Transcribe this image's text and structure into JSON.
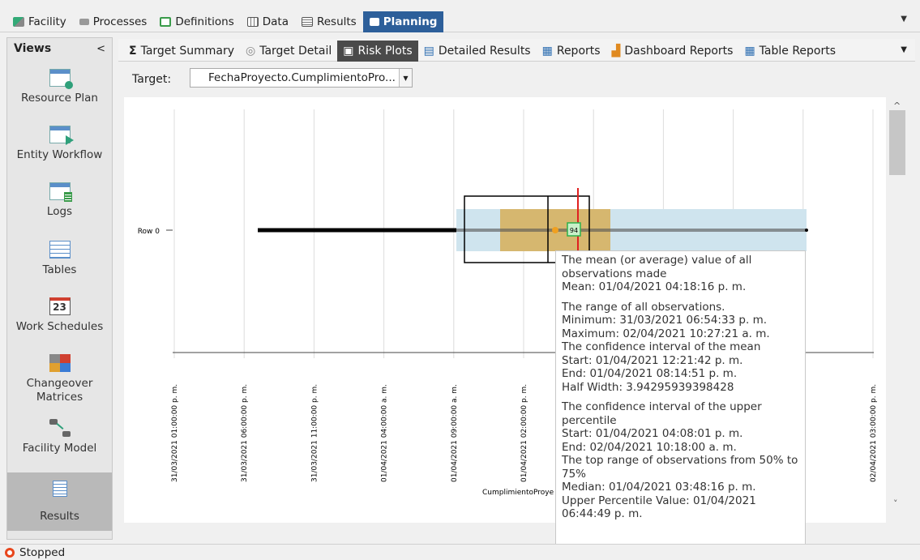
{
  "top_tabs": [
    {
      "label": "Facility",
      "icon": "facility-icon",
      "active": false
    },
    {
      "label": "Processes",
      "icon": "processes-icon",
      "active": false
    },
    {
      "label": "Definitions",
      "icon": "definitions-icon",
      "active": false
    },
    {
      "label": "Data",
      "icon": "data-icon",
      "active": false
    },
    {
      "label": "Results",
      "icon": "results-icon",
      "active": false
    },
    {
      "label": "Planning",
      "icon": "planning-icon",
      "active": true
    }
  ],
  "views": {
    "title": "Views",
    "collapse": "<",
    "items": [
      {
        "label": "Resource Plan",
        "icon": "resource-plan-icon"
      },
      {
        "label": "Entity Workflow",
        "icon": "entity-workflow-icon"
      },
      {
        "label": "Logs",
        "icon": "logs-icon"
      },
      {
        "label": "Tables",
        "icon": "tables-icon"
      },
      {
        "label": "Work Schedules",
        "icon": "calendar-icon",
        "icon_text": "23"
      },
      {
        "label": "Changeover Matrices",
        "icon": "changeover-icon"
      },
      {
        "label": "Facility Model",
        "icon": "facility-model-icon"
      },
      {
        "label": "Results",
        "icon": "results-doc-icon",
        "selected": true
      }
    ]
  },
  "sub_tabs": [
    {
      "label": "Target Summary",
      "icon": "sigma-icon",
      "glyph": "Σ"
    },
    {
      "label": "Target Detail",
      "icon": "target-icon",
      "glyph": "◎"
    },
    {
      "label": "Risk Plots",
      "icon": "risk-plot-icon",
      "glyph": "▣",
      "active": true
    },
    {
      "label": "Detailed Results",
      "icon": "detailed-results-icon",
      "glyph": "▤"
    },
    {
      "label": "Reports",
      "icon": "reports-icon",
      "glyph": "▦"
    },
    {
      "label": "Dashboard Reports",
      "icon": "dashboard-icon",
      "glyph": "▟"
    },
    {
      "label": "Table Reports",
      "icon": "table-reports-icon",
      "glyph": "▦"
    }
  ],
  "target": {
    "label": "Target:",
    "value": "FechaProyecto.CumplimientoPro..."
  },
  "chart_data": {
    "type": "box",
    "orientation": "horizontal",
    "rows": [
      "Row 0"
    ],
    "x_ticks": [
      "31/03/2021 01:00:00 p. m.",
      "31/03/2021 06:00:00 p. m.",
      "31/03/2021 11:00:00 p. m.",
      "01/04/2021 04:00:00 a. m.",
      "01/04/2021 09:00:00 a. m.",
      "01/04/2021 02:00:00 p. m.",
      "",
      "",
      "",
      "",
      "02/04/2021 03:00:00 p. m."
    ],
    "x_label_partial": "CumplimientoProye",
    "marker_label": "94",
    "colors": {
      "range_band": "#cfe4ee",
      "box_fill": "#d6b76f",
      "mean_marker": "#f0a020",
      "upper_line": "#e02020",
      "marker_box": "#2db04b",
      "whisker": "#000000"
    }
  },
  "tooltip": {
    "mean_desc": "The mean (or average) value of all observations made",
    "mean": "Mean: 01/04/2021 04:18:16 p. m.",
    "range_desc": "The range of all observations.",
    "min": "Minimum: 31/03/2021 06:54:33 p. m.",
    "max": "Maximum: 02/04/2021 10:27:21 a. m.",
    "ci_mean_desc": "The confidence interval of the mean",
    "ci_mean_start": "Start: 01/04/2021 12:21:42 p. m.",
    "ci_mean_end": "End: 01/04/2021 08:14:51 p. m.",
    "ci_mean_half": "Half Width: 3.94295939398428",
    "ci_upper_desc": "The confidence interval of the upper percentile",
    "ci_upper_start": "Start: 01/04/2021 04:08:01 p. m.",
    "ci_upper_end": "End: 02/04/2021 10:18:00 a. m.",
    "top_range_desc": "The top range of observations from 50% to 75%",
    "median": "Median: 01/04/2021 03:48:16 p. m.",
    "upper_pct": "Upper Percentile Value: 01/04/2021 06:44:49 p. m."
  },
  "status": {
    "text": "Stopped"
  }
}
